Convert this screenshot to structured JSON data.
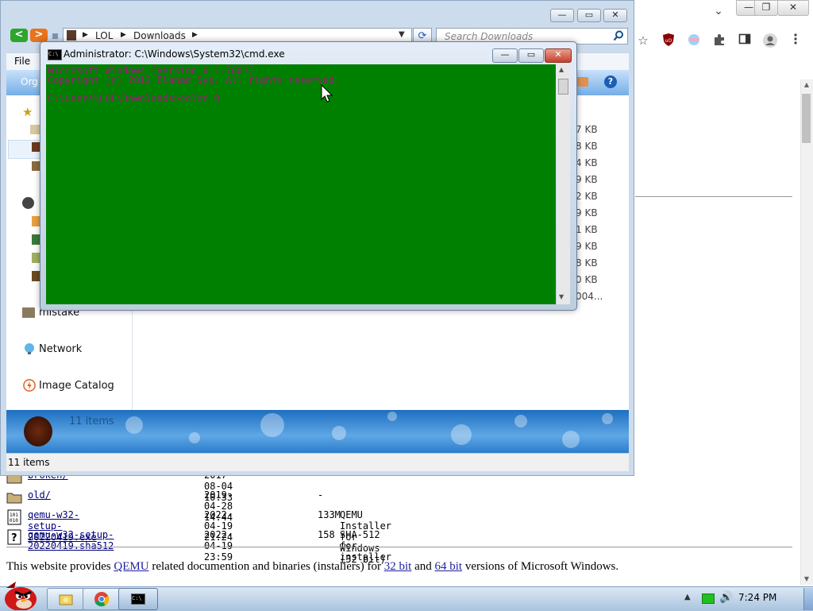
{
  "chrome": {
    "window_controls": {
      "minimize": "—",
      "restore": "❐",
      "close": "✕"
    },
    "tab_dropdown": "⌄",
    "extension_icons": [
      "star-icon",
      "ublock-icon",
      "colorful-extension-icon",
      "puzzle-icon",
      "sidepanel-icon",
      "profile-icon",
      "kebab-menu-icon"
    ]
  },
  "listing": {
    "rows": [
      {
        "icon": "folder",
        "name": "broken/",
        "date": "2017-08-04 10:33",
        "size": "-",
        "desc": ""
      },
      {
        "icon": "folder",
        "name": "old/",
        "date": "2019-04-28 14:44",
        "size": "-",
        "desc": ""
      },
      {
        "icon": "binary",
        "name": "qemu-w32-setup-20220419.exe",
        "date": "2022-04-19 21:24",
        "size": "133M",
        "desc": "QEMU Installer for Windows (32 bit)"
      },
      {
        "icon": "unknown",
        "name": "qemu-w32-setup-20220419.sha512",
        "date": "2022-04-19 23:59",
        "size": "158",
        "desc": "SHA-512 for installer"
      }
    ],
    "description": {
      "t1": "This website provides ",
      "link_qemu": "QEMU",
      "t2": " related documention and binaries (installers) for ",
      "link_32": "32 bit",
      "t3": " and ",
      "link_64": "64 bit",
      "t4": " versions of Microsoft Windows."
    }
  },
  "explorer": {
    "address": {
      "seg1": "LOL",
      "seg2": "Downloads"
    },
    "search_placeholder": "Search Downloads",
    "menu_file": "File",
    "toolbar_organize": "Org",
    "nav": [
      {
        "label": "mistake",
        "icon": "folder-icon"
      },
      {
        "label": "Network",
        "icon": "network-icon"
      },
      {
        "label": "Image Catalog",
        "icon": "image-catalog-icon"
      }
    ],
    "sizes": [
      "7 KB",
      "8 KB",
      "4 KB",
      "9 KB",
      "2 KB",
      "9 KB",
      "1 KB",
      "9 KB",
      "8 KB",
      "0 KB",
      "004..."
    ],
    "details_count": "11 items",
    "status_count": "11 items"
  },
  "cmd": {
    "title": "Administrator: C:\\Windows\\System32\\cmd.exe",
    "lines": [
      "Microsoft Windows [Version 6.1.7601]",
      "Copyright (c) 2012 Elahad Sys.  All rights reserved.",
      "",
      "C:\\Users\\LOL\\Downloads>color 0"
    ]
  },
  "taskbar": {
    "clock": "7:24 PM",
    "buttons": [
      "explorer-folder-icon",
      "chrome-icon",
      "cmd-icon"
    ]
  }
}
